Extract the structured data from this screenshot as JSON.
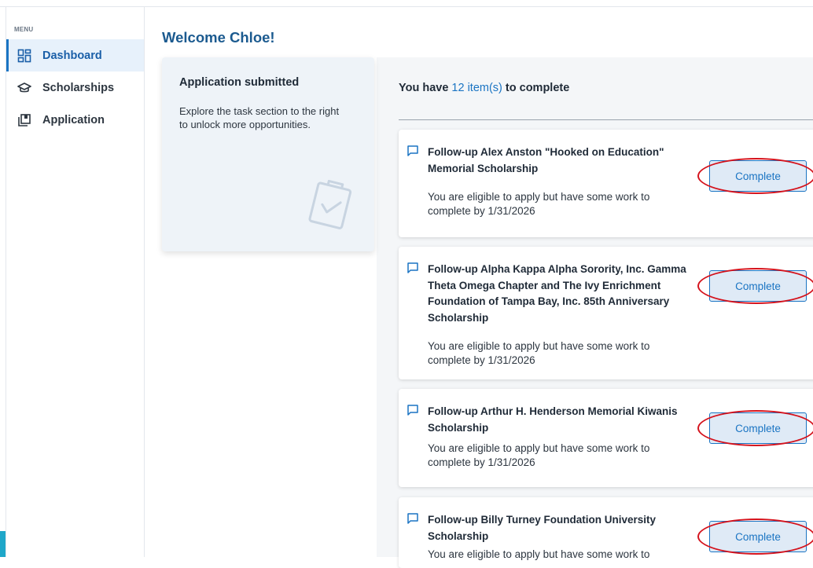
{
  "sidebar": {
    "menu_label": "MENU",
    "items": [
      {
        "label": "Dashboard",
        "icon": "dashboard-icon",
        "active": true
      },
      {
        "label": "Scholarships",
        "icon": "graduation-cap-icon",
        "active": false
      },
      {
        "label": "Application",
        "icon": "application-icon",
        "active": false
      }
    ]
  },
  "main": {
    "welcome": "Welcome Chloe!",
    "status_card": {
      "title": "Application submitted",
      "text": "Explore the task section to the right to unlock more opportunities.",
      "icon": "clipboard-check-icon"
    },
    "items_header": {
      "prefix": "You have ",
      "count": "12 item(s)",
      "suffix": " to complete"
    },
    "tasks": [
      {
        "title": "Follow-up Alex Anston \"Hooked on Education\" Memorial Scholarship",
        "description": "You are eligible to apply but have some work to complete by 1/31/2026",
        "button": "Complete"
      },
      {
        "title": "Follow-up Alpha Kappa Alpha Sorority, Inc. Gamma Theta Omega Chapter and The Ivy Enrichment Foundation of Tampa Bay, Inc. 85th Anniversary Scholarship",
        "description": "You are eligible to apply but have some work to complete by 1/31/2026",
        "button": "Complete"
      },
      {
        "title": "Follow-up Arthur H. Henderson Memorial Kiwanis Scholarship",
        "description": "You are eligible to apply but have some work to complete by 1/31/2026",
        "button": "Complete"
      },
      {
        "title": "Follow-up Billy Turney Foundation University Scholarship",
        "description": "You are eligible to apply but have some work to",
        "button": "Complete"
      }
    ]
  },
  "colors": {
    "accent": "#1a74c3",
    "heading": "#1b5a8f",
    "annotation_ring": "#d4121c",
    "sidebar_active_bg": "#e7f1fb"
  }
}
